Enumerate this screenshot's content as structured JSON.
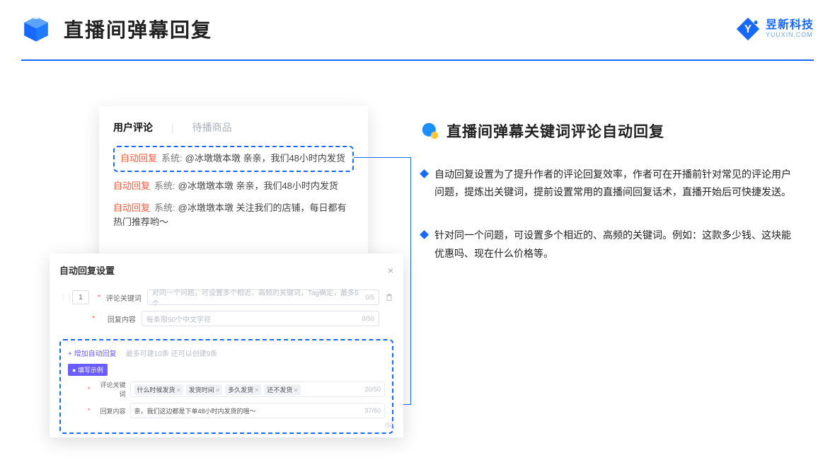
{
  "header": {
    "title": "直播间弹幕回复",
    "brand_cn": "昱新科技",
    "brand_en": "YUUXIN.COM"
  },
  "desc": {
    "title": "直播间弹幕关键词评论自动回复",
    "points": [
      "自动回复设置为了提升作者的评论回复效率，作者可在开播前针对常见的评论用户问题，提炼出关键词，提前设置常用的直播间回复话术，直播开始后可快捷发送。",
      "针对同一个问题，可设置多个相近的、高频的关键词。例如：这款多少钱、这块能优惠吗、现在什么价格等。"
    ]
  },
  "comments": {
    "tab_active": "用户评论",
    "tab_inactive": "待播商品",
    "items": [
      {
        "ar": "自动回复",
        "sys": "系统:",
        "text": "@冰墩墩本墩 亲亲，我们48小时内发货"
      },
      {
        "ar": "自动回复",
        "sys": "系统:",
        "text": "@冰墩墩本墩 亲亲，我们48小时内发货"
      },
      {
        "ar": "自动回复",
        "sys": "系统:",
        "text": "@冰墩墩本墩 关注我们的店铺，每日都有热门推荐哟～"
      }
    ]
  },
  "settings": {
    "title": "自动回复设置",
    "idx": "1",
    "keyword_label": "评论关键词",
    "keyword_placeholder": "对同一个问题，可设置多个相近、高频的关键词，Tag确定，最多5个",
    "keyword_counter": "0/5",
    "content_label": "回复内容",
    "content_placeholder": "每条限50个中文字符",
    "content_counter": "0/50",
    "add_link": "+ 增加自动回复",
    "add_hint": "最多可建10条 还可以创建9条",
    "example_chip": "● 填写示例",
    "ex_keyword_label": "评论关键词",
    "ex_tags": [
      "什么时候发货",
      "发货时间",
      "多久发货",
      "还不发货"
    ],
    "ex_keyword_counter": "20/50",
    "ex_content_label": "回复内容",
    "ex_content_value": "亲，我们这边都是下单48小时内发货的哦～",
    "ex_content_counter": "37/50",
    "floating_counter": "/50"
  },
  "icons": {
    "close": "×",
    "tag_x": "×"
  }
}
